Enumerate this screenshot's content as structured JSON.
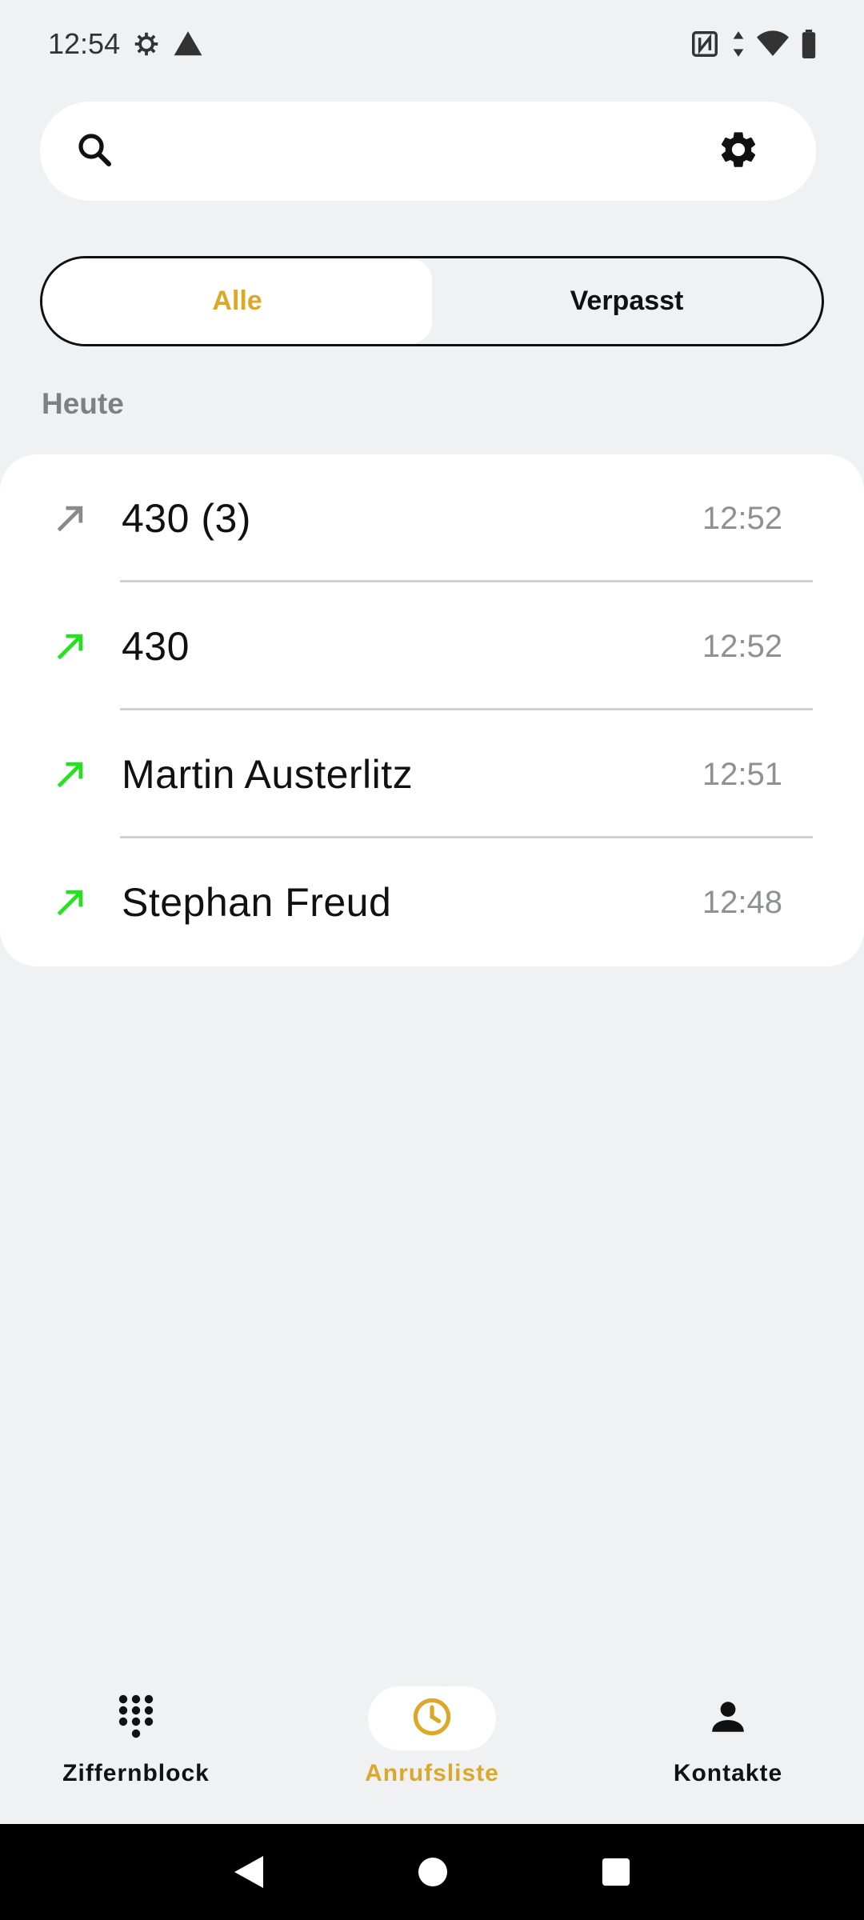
{
  "status_bar": {
    "time": "12:54",
    "icons_left": [
      "gear-status-icon",
      "warning-icon"
    ],
    "icons_right": [
      "nfc-icon",
      "data-arrows-icon",
      "wifi-icon",
      "battery-icon"
    ]
  },
  "search": {
    "placeholder": "",
    "value": ""
  },
  "filter_tabs": [
    {
      "label": "Alle",
      "active": true
    },
    {
      "label": "Verpasst",
      "active": false
    }
  ],
  "section": {
    "title": "Heute"
  },
  "calls": [
    {
      "name": "430 (3)",
      "time": "12:52",
      "direction": "outgoing",
      "color": "#8a8a8a"
    },
    {
      "name": "430",
      "time": "12:52",
      "direction": "outgoing",
      "color": "#22e31e"
    },
    {
      "name": "Martin Austerlitz",
      "time": "12:51",
      "direction": "outgoing",
      "color": "#22e31e"
    },
    {
      "name": "Stephan Freud",
      "time": "12:48",
      "direction": "outgoing",
      "color": "#22e31e"
    }
  ],
  "bottom_nav": [
    {
      "label": "Ziffernblock",
      "icon": "dialpad-icon",
      "active": false
    },
    {
      "label": "Anrufsliste",
      "icon": "clock-icon",
      "active": true
    },
    {
      "label": "Kontakte",
      "icon": "person-icon",
      "active": false
    }
  ],
  "colors": {
    "accent": "#dba82a",
    "background": "#eff1f3",
    "card": "#ffffff",
    "outgoing_green": "#22e31e",
    "muted_gray": "#8a8a8a"
  }
}
